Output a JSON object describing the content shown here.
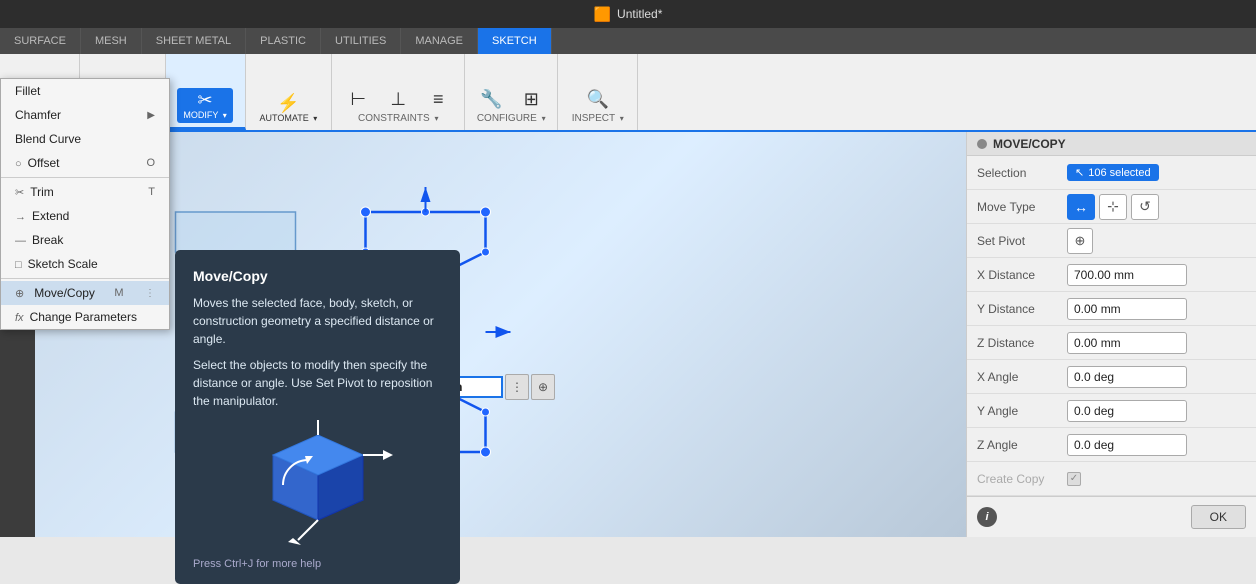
{
  "app": {
    "title": "Untitled*",
    "title_icon": "🟧"
  },
  "top_tabs": [
    {
      "label": "SURFACE",
      "active": false
    },
    {
      "label": "MESH",
      "active": false
    },
    {
      "label": "SHEET METAL",
      "active": false
    },
    {
      "label": "PLASTIC",
      "active": false
    },
    {
      "label": "UTILITIES",
      "active": false
    },
    {
      "label": "MANAGE",
      "active": false
    },
    {
      "label": "SKETCH",
      "active": true
    }
  ],
  "ribbon_groups": [
    {
      "label": "MESH"
    },
    {
      "label": "SHEET METAL"
    },
    {
      "label": "PLASTIC"
    },
    {
      "label": "UTILITIES"
    },
    {
      "label": "MANAGE"
    },
    {
      "label": "SKETCH"
    }
  ],
  "modify_group": {
    "label": "MODIFY",
    "active": true
  },
  "automate_group": {
    "label": "AUTOMATE"
  },
  "constraints_group": {
    "label": "CONSTRAINTS"
  },
  "configure_group": {
    "label": "CONFIGURE"
  },
  "inspect_group": {
    "label": "INSPECT"
  },
  "dropdown_items": [
    {
      "label": "Fillet",
      "shortcut": "",
      "has_sub": false,
      "icon": ""
    },
    {
      "label": "Chamfer",
      "shortcut": "",
      "has_sub": true,
      "icon": ""
    },
    {
      "label": "Blend Curve",
      "shortcut": "",
      "has_sub": false,
      "icon": ""
    },
    {
      "label": "Offset",
      "shortcut": "O",
      "has_sub": false,
      "icon": "○"
    },
    {
      "label": "Trim",
      "shortcut": "T",
      "has_sub": false,
      "icon": "✂"
    },
    {
      "label": "Extend",
      "shortcut": "",
      "has_sub": false,
      "icon": ""
    },
    {
      "label": "Break",
      "shortcut": "",
      "has_sub": false,
      "icon": ""
    },
    {
      "label": "Sketch Scale",
      "shortcut": "",
      "has_sub": false,
      "icon": "□"
    },
    {
      "label": "Move/Copy",
      "shortcut": "M",
      "has_sub": false,
      "icon": "⊕",
      "active": true
    },
    {
      "label": "Change Parameters",
      "shortcut": "",
      "has_sub": false,
      "icon": "fx"
    }
  ],
  "tooltip": {
    "title": "Move/Copy",
    "body1": "Moves the selected face, body, sketch, or construction geometry a specified distance or angle.",
    "body2": "Select the objects to modify then specify the distance or angle. Use Set Pivot to reposition the manipulator.",
    "hint": "Press Ctrl+J for more help"
  },
  "viewport": {
    "dimension_label": "700.00",
    "input_value": "700.00 mm"
  },
  "right_panel": {
    "header": "MOVE/COPY",
    "selection_label": "Selection",
    "selection_value": "106 selected",
    "move_type_label": "Move Type",
    "set_pivot_label": "Set Pivot",
    "x_distance_label": "X Distance",
    "x_distance_value": "700.00 mm",
    "y_distance_label": "Y Distance",
    "y_distance_value": "0.00 mm",
    "z_distance_label": "Z Distance",
    "z_distance_value": "0.00 mm",
    "x_angle_label": "X Angle",
    "x_angle_value": "0.0 deg",
    "y_angle_label": "Y Angle",
    "y_angle_value": "0.0 deg",
    "z_angle_label": "Z Angle",
    "z_angle_value": "0.0 deg",
    "create_copy_label": "Create Copy",
    "ok_label": "OK"
  }
}
